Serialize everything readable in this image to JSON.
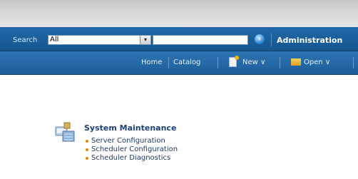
{
  "search": {
    "label": "Search",
    "scope": "All",
    "dropdown_icon": "chevron-down-icon",
    "go_icon": "go-arrow-icon",
    "admin_link": "Administration"
  },
  "nav": {
    "home": "Home",
    "catalog": "Catalog",
    "new": "New ∨",
    "open": "Open ∨"
  },
  "section": {
    "title": "System Maintenance",
    "items": [
      "Server Configuration",
      "Scheduler Configuration",
      "Scheduler Diagnostics"
    ]
  },
  "colors": {
    "bar_blue": "#1f6aa8",
    "nav_blue": "#2d74b2",
    "link_blue": "#1f3a6a",
    "bullet_orange": "#e08a00"
  }
}
